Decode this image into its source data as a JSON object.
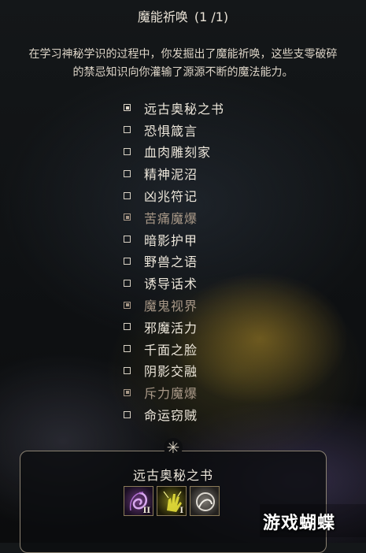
{
  "header": {
    "title": "魔能祈唤",
    "count": "(1 /1)"
  },
  "description": {
    "line1": "在学习神秘学识的过程中，你发掘出了魔能祈唤，这些支零破碎",
    "line2": "的禁忌知识向你灌输了源源不断的魔法能力。"
  },
  "invocations": [
    {
      "label": "远古奥秘之书",
      "checked": true,
      "dim": false
    },
    {
      "label": "恐惧箴言",
      "checked": false,
      "dim": false
    },
    {
      "label": "血肉雕刻家",
      "checked": false,
      "dim": false
    },
    {
      "label": "精神泥沼",
      "checked": false,
      "dim": false
    },
    {
      "label": "凶兆符记",
      "checked": false,
      "dim": false
    },
    {
      "label": "苦痛魔爆",
      "checked": true,
      "dim": true
    },
    {
      "label": "暗影护甲",
      "checked": false,
      "dim": false
    },
    {
      "label": "野兽之语",
      "checked": false,
      "dim": false
    },
    {
      "label": "诱导话术",
      "checked": false,
      "dim": false
    },
    {
      "label": "魔鬼视界",
      "checked": true,
      "dim": true
    },
    {
      "label": "邪魔活力",
      "checked": false,
      "dim": false
    },
    {
      "label": "千面之脸",
      "checked": false,
      "dim": false
    },
    {
      "label": "阴影交融",
      "checked": false,
      "dim": false
    },
    {
      "label": "斥力魔爆",
      "checked": true,
      "dim": true
    },
    {
      "label": "命运窃贼",
      "checked": false,
      "dim": false
    }
  ],
  "selected_panel": {
    "star_icon": "sparkle-icon",
    "title": "远古奥秘之书",
    "spells": [
      {
        "icon": "purple-spiral-spell-icon",
        "level": "II"
      },
      {
        "icon": "yellow-hand-spell-icon",
        "level": "I"
      },
      {
        "icon": "grey-swirl-spell-icon",
        "level": ""
      }
    ]
  },
  "watermark": "游戏蝴蝶",
  "colors": {
    "text": "#ece6da",
    "dim_text": "#a89887",
    "panel_border": "#8b8272",
    "background": "#0e1012"
  }
}
